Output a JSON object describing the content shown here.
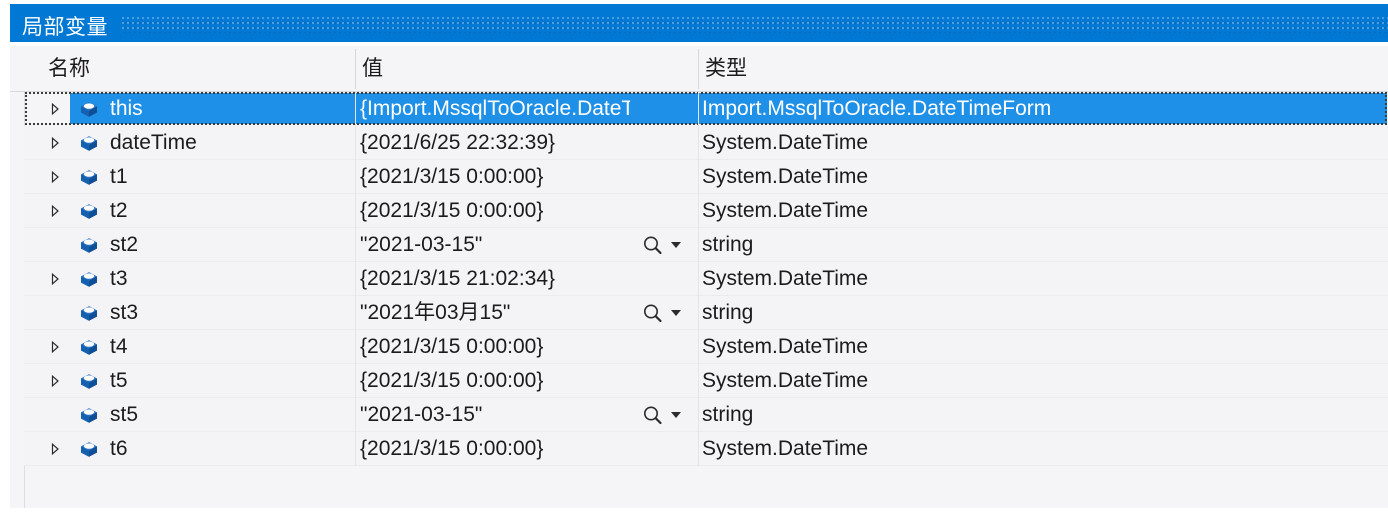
{
  "window": {
    "title": "局部变量",
    "accent_color": "#0078d4",
    "selection_color": "#1e90e8"
  },
  "grid": {
    "columns": [
      {
        "key": "name",
        "label": "名称"
      },
      {
        "key": "value",
        "label": "值"
      },
      {
        "key": "type",
        "label": "类型"
      }
    ],
    "rows": [
      {
        "name": "this",
        "value": "{Import.MssqlToOracle.DateT...",
        "type": "Import.MssqlToOracle.DateTimeForm",
        "expandable": true,
        "selected": true,
        "visualizer": false,
        "icon": "variable-cube-icon"
      },
      {
        "name": "dateTime",
        "value": "{2021/6/25 22:32:39}",
        "type": "System.DateTime",
        "expandable": true,
        "selected": false,
        "visualizer": false,
        "icon": "variable-cube-icon"
      },
      {
        "name": "t1",
        "value": "{2021/3/15 0:00:00}",
        "type": "System.DateTime",
        "expandable": true,
        "selected": false,
        "visualizer": false,
        "icon": "variable-cube-icon"
      },
      {
        "name": "t2",
        "value": "{2021/3/15 0:00:00}",
        "type": "System.DateTime",
        "expandable": true,
        "selected": false,
        "visualizer": false,
        "icon": "variable-cube-icon"
      },
      {
        "name": "st2",
        "value": "\"2021-03-15\"",
        "type": "string",
        "expandable": false,
        "selected": false,
        "visualizer": true,
        "icon": "variable-cube-icon"
      },
      {
        "name": "t3",
        "value": "{2021/3/15 21:02:34}",
        "type": "System.DateTime",
        "expandable": true,
        "selected": false,
        "visualizer": false,
        "icon": "variable-cube-icon"
      },
      {
        "name": "st3",
        "value": "\"2021年03月15\"",
        "type": "string",
        "expandable": false,
        "selected": false,
        "visualizer": true,
        "icon": "variable-cube-icon"
      },
      {
        "name": "t4",
        "value": "{2021/3/15 0:00:00}",
        "type": "System.DateTime",
        "expandable": true,
        "selected": false,
        "visualizer": false,
        "icon": "variable-cube-icon"
      },
      {
        "name": "t5",
        "value": "{2021/3/15 0:00:00}",
        "type": "System.DateTime",
        "expandable": true,
        "selected": false,
        "visualizer": false,
        "icon": "variable-cube-icon"
      },
      {
        "name": "st5",
        "value": "\"2021-03-15\"",
        "type": "string",
        "expandable": false,
        "selected": false,
        "visualizer": true,
        "icon": "variable-cube-icon"
      },
      {
        "name": "t6",
        "value": "{2021/3/15 0:00:00}",
        "type": "System.DateTime",
        "expandable": true,
        "selected": false,
        "visualizer": false,
        "icon": "variable-cube-icon"
      }
    ]
  }
}
